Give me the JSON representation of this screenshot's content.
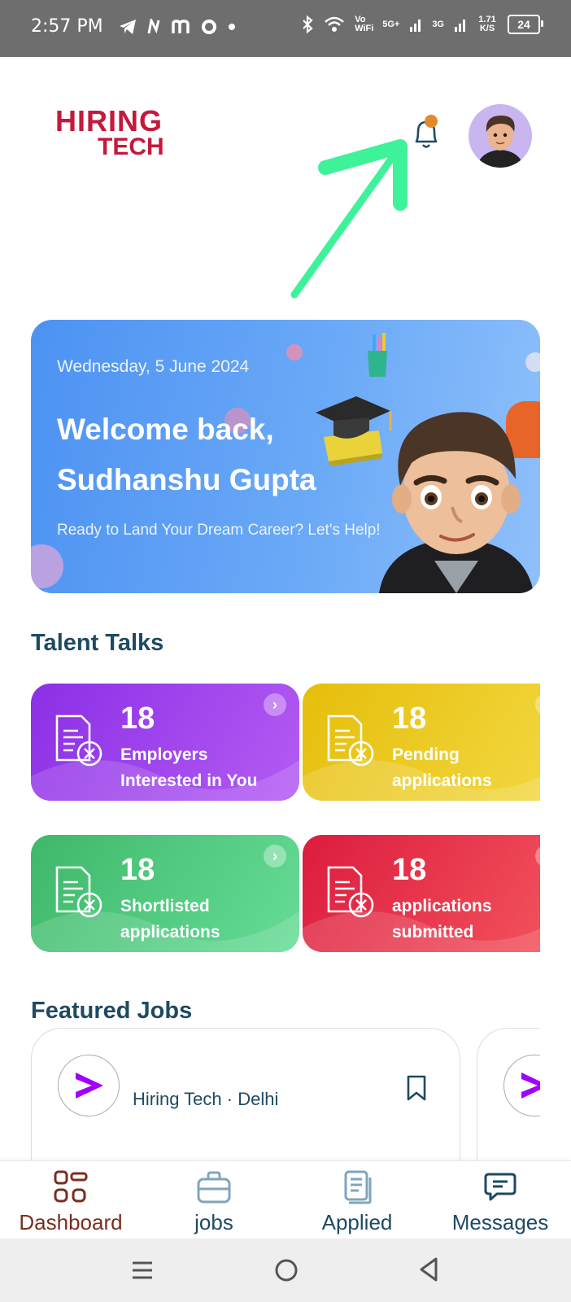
{
  "status_bar": {
    "time": "2:57 PM",
    "signal_labels": [
      "Vo WiFi",
      "5G+",
      "3G"
    ],
    "speed": "1.71 K/S",
    "battery": "24"
  },
  "header": {
    "logo_line1": "HIRING",
    "logo_line2": "TECH",
    "notification_icon": "bell-icon",
    "avatar_icon": "user-avatar"
  },
  "banner": {
    "date": "Wednesday, 5 June 2024",
    "greeting_line1": "Welcome back,",
    "greeting_line2": "Sudhanshu Gupta",
    "tagline": "Ready to Land Your Dream Career? Let's Help!"
  },
  "talent_talks": {
    "title": "Talent Talks",
    "cards": [
      {
        "count": "18",
        "label": "Employers Interested in You",
        "color_from": "#8b2fe6",
        "color_to": "#c067f5"
      },
      {
        "count": "18",
        "label": "Pending applications",
        "color_from": "#e6be0b",
        "color_to": "#f5dc49"
      },
      {
        "count": "18",
        "label": "Shortlisted applications",
        "color_from": "#3fb86a",
        "color_to": "#6fe3a0"
      },
      {
        "count": "18",
        "label": "applications submitted",
        "color_from": "#dc1c3e",
        "color_to": "#f65a62"
      }
    ]
  },
  "featured_jobs": {
    "title": "Featured Jobs",
    "jobs": [
      {
        "company": "Hiring Tech · Delhi"
      }
    ]
  },
  "bottom_nav": {
    "items": [
      {
        "label": "Dashboard",
        "active": true
      },
      {
        "label": "jobs",
        "active": false
      },
      {
        "label": "Applied",
        "active": false
      },
      {
        "label": "Messages",
        "active": false
      }
    ],
    "active_color": "#7a2e1f",
    "inactive_color": "#1e4a63"
  },
  "colors": {
    "brand": "#c4193d",
    "heading": "#1e4a63",
    "annotation_arrow": "#3ef29a"
  }
}
